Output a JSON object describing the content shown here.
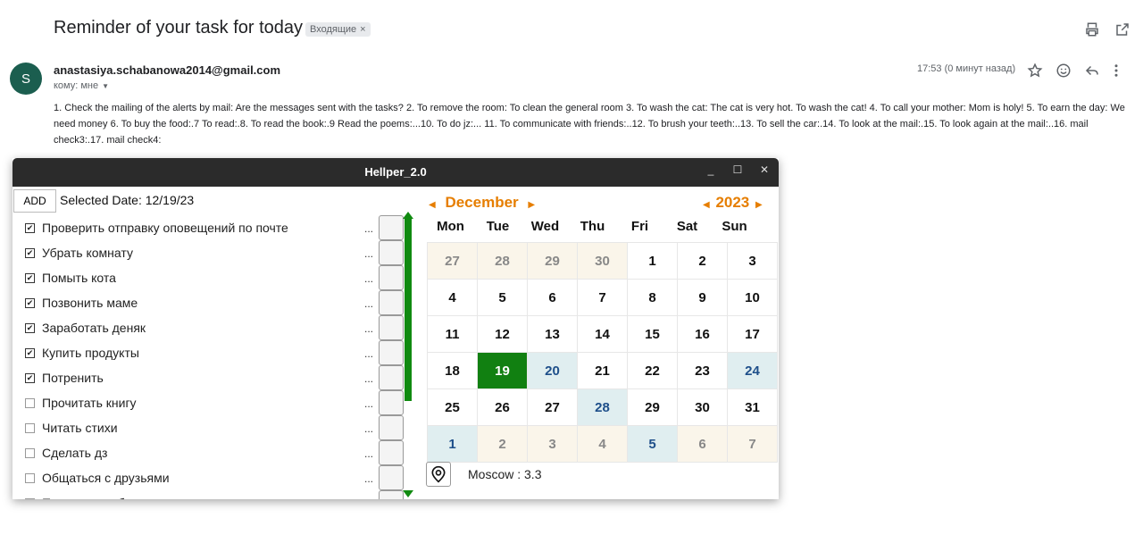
{
  "email": {
    "subject": "Reminder of your task for today",
    "label": "Входящие",
    "sender_initial": "S",
    "sender": "anastasiya.schabanowa2014@gmail.com",
    "to": "кому: мне",
    "timestamp": "17:53 (0 минут назад)",
    "body": "1. Check the mailing of the alerts by mail: Are the messages sent with the tasks? 2. To remove the room: To clean the general room 3. To wash the cat: The cat is very hot. To wash the cat! 4. To call your mother: Mom is holy! 5. To earn the day: We need money 6. To buy the food:.7 To read:.8. To read the book:.9 Read the poems:...10. To do jz:... 11. To communicate with friends:..12. To brush your teeth:..13. To sell the car:.14. To look at the mail:.15. To look again at the mail:..16. mail check3:.17. mail check4:"
  },
  "app": {
    "title": "Hellper_2.0",
    "add_label": "ADD",
    "selected_date": "Selected Date: 12/19/23",
    "tasks": [
      {
        "label": "Проверить отправку оповещений по почте",
        "done": true,
        "icon": "computer-icon"
      },
      {
        "label": "Убрать комнату",
        "done": true,
        "icon": "cleaning-icon"
      },
      {
        "label": "Помыть кота",
        "done": true,
        "icon": "cleaning-icon"
      },
      {
        "label": "Позвонить маме",
        "done": true,
        "icon": "people-icon"
      },
      {
        "label": "Заработать деняк",
        "done": true,
        "icon": "money-icon"
      },
      {
        "label": "Купить продукты",
        "done": true,
        "icon": "people-icon"
      },
      {
        "label": "Потренить",
        "done": true,
        "icon": "people-icon"
      },
      {
        "label": "Прочитать книгу",
        "done": false,
        "icon": "food-icon"
      },
      {
        "label": "Читать стихи",
        "done": false,
        "icon": "food-icon"
      },
      {
        "label": "Сделать дз",
        "done": false,
        "icon": "computer-icon"
      },
      {
        "label": "Общаться с друзьями",
        "done": false,
        "icon": "food-icon"
      },
      {
        "label": "Почистить зубы",
        "done": false,
        "icon": "people-icon"
      }
    ],
    "calendar": {
      "month": "December",
      "year": "2023",
      "weekdays": [
        "Mon",
        "Tue",
        "Wed",
        "Thu",
        "Fri",
        "Sat",
        "Sun"
      ],
      "weeks": [
        [
          {
            "d": "27",
            "k": "out"
          },
          {
            "d": "28",
            "k": "out"
          },
          {
            "d": "29",
            "k": "out"
          },
          {
            "d": "30",
            "k": "out"
          },
          {
            "d": "1",
            "k": "cur"
          },
          {
            "d": "2",
            "k": "cur"
          },
          {
            "d": "3",
            "k": "cur"
          }
        ],
        [
          {
            "d": "4",
            "k": "cur"
          },
          {
            "d": "5",
            "k": "cur"
          },
          {
            "d": "6",
            "k": "cur"
          },
          {
            "d": "7",
            "k": "cur"
          },
          {
            "d": "8",
            "k": "cur"
          },
          {
            "d": "9",
            "k": "cur"
          },
          {
            "d": "10",
            "k": "cur"
          }
        ],
        [
          {
            "d": "11",
            "k": "cur"
          },
          {
            "d": "12",
            "k": "cur"
          },
          {
            "d": "13",
            "k": "cur"
          },
          {
            "d": "14",
            "k": "cur"
          },
          {
            "d": "15",
            "k": "cur"
          },
          {
            "d": "16",
            "k": "cur"
          },
          {
            "d": "17",
            "k": "cur"
          }
        ],
        [
          {
            "d": "18",
            "k": "cur"
          },
          {
            "d": "19",
            "k": "sel"
          },
          {
            "d": "20",
            "k": "mark"
          },
          {
            "d": "21",
            "k": "cur"
          },
          {
            "d": "22",
            "k": "cur"
          },
          {
            "d": "23",
            "k": "cur"
          },
          {
            "d": "24",
            "k": "mark"
          }
        ],
        [
          {
            "d": "25",
            "k": "cur"
          },
          {
            "d": "26",
            "k": "cur"
          },
          {
            "d": "27",
            "k": "cur"
          },
          {
            "d": "28",
            "k": "mark"
          },
          {
            "d": "29",
            "k": "cur"
          },
          {
            "d": "30",
            "k": "cur"
          },
          {
            "d": "31",
            "k": "cur"
          }
        ],
        [
          {
            "d": "1",
            "k": "mark"
          },
          {
            "d": "2",
            "k": "out"
          },
          {
            "d": "3",
            "k": "out"
          },
          {
            "d": "4",
            "k": "out"
          },
          {
            "d": "5",
            "k": "mark"
          },
          {
            "d": "6",
            "k": "out"
          },
          {
            "d": "7",
            "k": "out"
          }
        ]
      ]
    },
    "weather": "Moscow : 3.3"
  },
  "colors": {
    "accent": "#e67e00",
    "selected_day": "#118011",
    "scrollbar": "#108a10",
    "avatar": "#1b5e4f"
  }
}
